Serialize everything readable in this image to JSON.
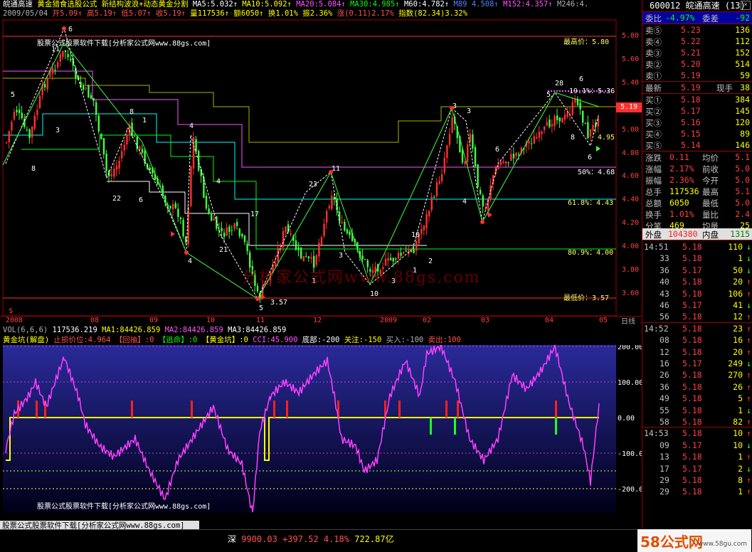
{
  "window": {
    "title": "皖通高速",
    "close_icon": "close-icon"
  },
  "header": {
    "line1": {
      "formula_name": "黄金猎食选股公式",
      "formula_desc": "新结构波浪+动态黄金分割",
      "ma5": "MA5:5.032↑",
      "ma10": "MA10:5.092↑",
      "ma20": "MA20:5.084↑",
      "ma30": "MA30:4.985↑",
      "m60": "M60:4.782↑",
      "m89": "M89 4.508↑",
      "m152": "M152:4.357↑",
      "m246": "M246:4."
    },
    "line2": {
      "date": "2009/05/04",
      "open": "开5.09↑",
      "high": "高5.19↑",
      "low": "低5.07↑",
      "close": "收5.19↑",
      "volume": "量117536↑",
      "amount": "额6050↑",
      "turnover": "换1.01%",
      "amplitude": "振2.36%",
      "change": "涨(0.11)2.17%",
      "index": "指数(82.34)3.32%"
    }
  },
  "main_labels": {
    "watermark_top": "股票公式股票软件下载[分析家公式网www.88gs.com]",
    "watermark_center": "分析家公式网www.88gs.com",
    "highest": "最高价：5.80",
    "lowest": "最低价：3.57",
    "fib50": "50%：4.68",
    "fib618": "61.8%：4.43",
    "fib809": "80.9%：4.00",
    "fib19": "19.1%：5.36",
    "fib809b": "4.95",
    "low_mark": "3.57",
    "current_price": "5.19",
    "dollar": "$"
  },
  "wave_labels": [
    "5",
    "11",
    "6",
    "3",
    "8",
    "22",
    "6",
    "4",
    "4",
    "21",
    "17",
    "23",
    "3",
    "11",
    "1",
    "5",
    "10",
    "3",
    "10",
    "1",
    "2",
    "6",
    "3",
    "4",
    "6",
    "3",
    "8",
    "1",
    "28",
    "6",
    "5",
    "8",
    "4"
  ],
  "price_axis": [
    "5.80",
    "5.60",
    "5.40",
    "5.20",
    "5.00",
    "4.80",
    "4.60",
    "4.40",
    "4.20",
    "4.00",
    "3.80",
    "3.60"
  ],
  "date_axis": [
    "2008",
    "08",
    "09",
    "10",
    "11",
    "12",
    "2009",
    "02",
    "03",
    "04",
    "05"
  ],
  "sum_button": "日线",
  "volume_line": {
    "name": "VOL(6,6,6)",
    "value": "117536.219",
    "ma1": "MA1:84426.859",
    "ma2": "MA2:84426.859",
    "ma3": "MA3:84426.859"
  },
  "indicator": {
    "name": "黄金坑(解盘)",
    "stop": "止损价位:4.964",
    "pullback": "【回抽】:0",
    "escape": "【逃命】:0",
    "pit": "【黄金坑】:0",
    "cci": "CCI:45.900",
    "bottom": "底部:-200",
    "watch": "关注:-150",
    "buy": "买入:-100",
    "sell": "卖出:100",
    "axis": [
      "200.00",
      "100.00",
      "0.00",
      "-100.00",
      "-200.00"
    ],
    "watermark": "股票公式股票软件下载[分析家公式网www.88gs.com]"
  },
  "status": {
    "site_link": "股票公式股票软件下载[分析家公式网www.88gs.com]",
    "ticker": {
      "market": "深",
      "index": "9900.03",
      "change": "+397.52",
      "pct": "4.18%",
      "amount": "722.87亿"
    }
  },
  "logo": {
    "text": "58公式网",
    "url_text": "www.58gu.com"
  },
  "quote_panel": {
    "code": "600012",
    "name": "皖通高速",
    "count": "(13)",
    "weibi_label": "委比",
    "weibi": "-4.97%",
    "weicha_label": "委差",
    "weicha": "-92",
    "asks": [
      {
        "label": "卖⑤",
        "price": "5.23",
        "vol": "136"
      },
      {
        "label": "卖④",
        "price": "5.22",
        "vol": "112"
      },
      {
        "label": "卖③",
        "price": "5.21",
        "vol": "152"
      },
      {
        "label": "卖②",
        "price": "5.20",
        "vol": "514"
      },
      {
        "label": "卖①",
        "price": "5.19",
        "vol": "59"
      }
    ],
    "latest_label": "最新",
    "latest": "5.19",
    "hand_label": "现手",
    "hand": "38",
    "bids": [
      {
        "label": "买①",
        "price": "5.18",
        "vol": "384"
      },
      {
        "label": "买②",
        "price": "5.17",
        "vol": "145"
      },
      {
        "label": "买③",
        "price": "5.16",
        "vol": "120"
      },
      {
        "label": "买④",
        "price": "5.15",
        "vol": "89"
      },
      {
        "label": "买⑤",
        "price": "5.14",
        "vol": "146"
      }
    ],
    "stats": [
      {
        "l1": "涨跌",
        "v1": "0.11",
        "l2": "均价",
        "v2": "5.1"
      },
      {
        "l1": "涨幅",
        "v1": "2.17%",
        "l2": "前收",
        "v2": "5.0"
      },
      {
        "l1": "振幅",
        "v1": "2.36%",
        "l2": "今开",
        "v2": "5.0"
      },
      {
        "l1": "总手",
        "v1": "117536",
        "l2": "最高",
        "v2": "5.1"
      },
      {
        "l1": "总额",
        "v1": "6050",
        "l2": "最低",
        "v2": "5.0"
      },
      {
        "l1": "换手",
        "v1": "1.01%",
        "l2": "量比",
        "v2": "2.4"
      },
      {
        "l1": "分笔",
        "v1": "469",
        "l2": "均量",
        "v2": "25"
      }
    ],
    "outer_label": "外盘",
    "outer": "104380",
    "inner_label": "内盘",
    "inner": "1315",
    "ticks": [
      {
        "t": "14:51",
        "p": "5.18",
        "v": "110",
        "d": "↓"
      },
      {
        "t": "33",
        "p": "5.18",
        "v": "1",
        "d": "↓"
      },
      {
        "t": "36",
        "p": "5.17",
        "v": "50",
        "d": "↓"
      },
      {
        "t": "40",
        "p": "5.18",
        "v": "20",
        "d": "↑"
      },
      {
        "t": "43",
        "p": "5.18",
        "v": "106",
        "d": "↑"
      },
      {
        "t": "46",
        "p": "5.17",
        "v": "41",
        "d": "↓"
      },
      {
        "t": "56",
        "p": "5.18",
        "v": "12",
        "d": "↑"
      },
      {
        "t": "14:52",
        "p": "5.18",
        "v": "23",
        "d": "↑"
      },
      {
        "t": "08",
        "p": "5.18",
        "v": "16",
        "d": "↑"
      },
      {
        "t": "12",
        "p": "5.18",
        "v": "20",
        "d": "↑"
      },
      {
        "t": "16",
        "p": "5.17",
        "v": "249",
        "d": "↓"
      },
      {
        "t": "26",
        "p": "5.18",
        "v": "270",
        "d": "↑"
      },
      {
        "t": "36",
        "p": "5.18",
        "v": "26",
        "d": "↑"
      },
      {
        "t": "49",
        "p": "5.18",
        "v": "5",
        "d": "↑"
      },
      {
        "t": "55",
        "p": "5.18",
        "v": "1",
        "d": "↓"
      },
      {
        "t": "58",
        "p": "5.18",
        "v": "82",
        "d": "↑"
      },
      {
        "t": "14:53",
        "p": "5.18",
        "v": "10",
        "d": "↑"
      },
      {
        "t": "09",
        "p": "5.17",
        "v": "10",
        "d": "↓"
      },
      {
        "t": "13",
        "p": "5.18",
        "v": "1",
        "d": "↑"
      },
      {
        "t": "17",
        "p": "5.17",
        "v": "2",
        "d": "↓"
      },
      {
        "t": "29",
        "p": "5.18",
        "v": "8",
        "d": "↑"
      },
      {
        "t": "29",
        "p": "5.18",
        "v": "1",
        "d": "↑"
      }
    ]
  },
  "colors": {
    "up": "#ff3030",
    "down": "#40ff40",
    "cci": "#ff40ff",
    "ind_bg": "#0a0a60"
  }
}
